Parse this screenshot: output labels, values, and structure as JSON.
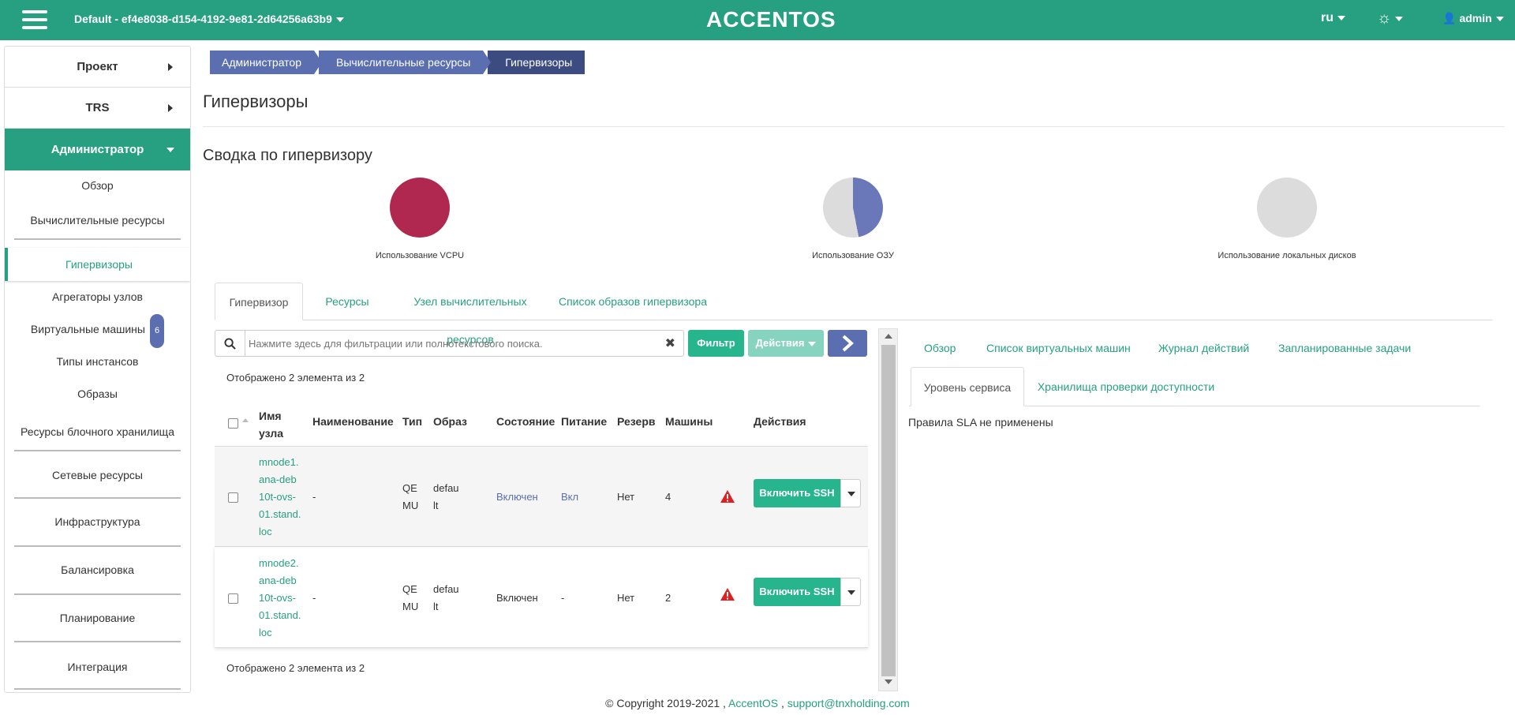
{
  "header": {
    "project": "Default - ef4e8038-d154-4192-9e81-2d64256a63b9",
    "logo": "ACCENTOS",
    "lang": "ru",
    "user": "admin"
  },
  "sidebar": {
    "project": "Проект",
    "trs": "TRS",
    "admin": "Администратор",
    "items": [
      "Обзор",
      "Вычислительные ресурсы",
      "Гипервизоры",
      "Агрегаторы узлов",
      "Виртуальные машины",
      "Типы инстансов",
      "Образы",
      "Ресурсы блочного хранилища",
      "Сетевые ресурсы",
      "Инфраструктура",
      "Балансировка",
      "Планирование",
      "Интеграция"
    ],
    "vm_badge": "6"
  },
  "breadcrumb": [
    "Администратор",
    "Вычислительные ресурсы",
    "Гипервизоры"
  ],
  "page_title": "Гипервизоры",
  "summary": {
    "title": "Сводка по гипервизору",
    "charts": [
      {
        "label": "Использование VCPU",
        "used_fraction": 1.0,
        "color": "#b0274f"
      },
      {
        "label": "Использование ОЗУ",
        "used_fraction": 0.47,
        "color": "#6a77b8"
      },
      {
        "label": "Использование локальных дисков",
        "used_fraction": 0.0,
        "color": "#dcdcdc"
      }
    ]
  },
  "tabs": [
    "Гипервизор",
    "Ресурсы",
    "Узел вычислительных ресурсов",
    "Список образов гипервизора"
  ],
  "search": {
    "placeholder": "Нажмите здесь для фильтрации или полнотекстового поиска."
  },
  "toolbar": {
    "filter": "Фильтр",
    "actions": "Действия"
  },
  "count_text": "Отображено 2 элемента из 2",
  "table": {
    "headers": [
      "Имя узла",
      "Наименование",
      "Тип",
      "Образ",
      "Состояние",
      "Питание",
      "Резерв",
      "Машины",
      "Действия"
    ],
    "header_name_line1": "Имя",
    "header_name_line2": "узла",
    "rows": [
      {
        "name_lines": [
          "mnode1.",
          "ana-deb",
          "10t-ovs-",
          "01.stand.",
          "loc"
        ],
        "title": "-",
        "type_lines": [
          "QE",
          "MU"
        ],
        "image_lines": [
          "defau",
          "lt"
        ],
        "state": "Включен",
        "power": "Вкл",
        "reserve": "Нет",
        "machines": "4",
        "action": "Включить SSH"
      },
      {
        "name_lines": [
          "mnode2.",
          "ana-deb",
          "10t-ovs-",
          "01.stand.",
          "loc"
        ],
        "title": "-",
        "type_lines": [
          "QE",
          "MU"
        ],
        "image_lines": [
          "defau",
          "lt"
        ],
        "state": "Включен",
        "power": "-",
        "reserve": "Нет",
        "machines": "2",
        "action": "Включить SSH"
      }
    ]
  },
  "detail": {
    "tabs": [
      "Обзор",
      "Список виртуальных машин",
      "Журнал действий",
      "Запланированные задачи"
    ],
    "subtabs": [
      "Уровень сервиса",
      "Хранилища проверки доступности"
    ],
    "sla_text": "Правила SLA не применены"
  },
  "footer": {
    "copyright": "© Copyright 2019-2021 ,",
    "link1": "AccentOS",
    "sep": ",",
    "link2": "support@tnxholding.com"
  }
}
